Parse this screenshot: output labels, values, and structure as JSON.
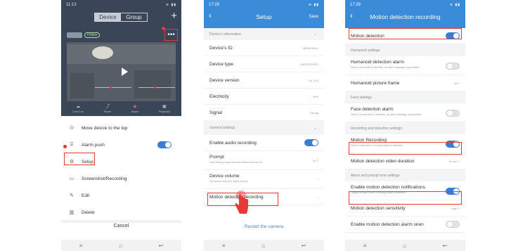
{
  "phone1": {
    "status_time": "11:13",
    "tabs": [
      {
        "label": "Device",
        "active": true
      },
      {
        "label": "Group",
        "active": false
      }
    ],
    "device_status": "Online",
    "more_icon": "ellipsis-icon",
    "controls": [
      {
        "label": "Cloud on",
        "icon": "cloud-icon"
      },
      {
        "label": "Share",
        "icon": "share-icon"
      },
      {
        "label": "Alarm",
        "icon": "alarm-icon"
      },
      {
        "label": "Playback",
        "icon": "playback-icon"
      }
    ],
    "menu": [
      {
        "label": "Move device to the top",
        "icon": "arrow-up-circle-icon",
        "toggle": null
      },
      {
        "label": "Alarm push",
        "icon": "bell-icon",
        "toggle": true
      },
      {
        "label": "Setup",
        "icon": "gear-icon",
        "toggle": null
      },
      {
        "label": "Screenshot/Recording",
        "icon": "image-icon",
        "toggle": null
      },
      {
        "label": "Edit",
        "icon": "pencil-icon",
        "toggle": null
      },
      {
        "label": "Delete",
        "icon": "trash-icon",
        "toggle": null
      }
    ],
    "cancel": "Cancel"
  },
  "phone2": {
    "status_time": "17:29",
    "title": "Setup",
    "save": "Save",
    "section1": "Device's information",
    "info_rows": [
      {
        "label": "Device's ID",
        "value": "3604816691"
      },
      {
        "label": "Device type",
        "value": "BATTERYIPC"
      },
      {
        "label": "Device version",
        "value": "3.0.13.0"
      },
      {
        "label": "Electricity",
        "value": "39%"
      },
      {
        "label": "Signal",
        "value": "Strong"
      }
    ],
    "section2": "General settings",
    "enable_audio": "Enable audio recording",
    "prompt": {
      "label": "Prompt",
      "sub": "Have audio prompt when the device is turned on",
      "value": "on"
    },
    "volume": {
      "label": "Device volume",
      "sub": "Set device input and output volume"
    },
    "motion_recording": "Motion detection recording",
    "restart": "Restart the camera"
  },
  "phone3": {
    "status_time": "17:29",
    "title": "Motion detection recording",
    "motion_detection": "Motion detection",
    "humanoid_settings": "Humanoid settings",
    "humanoid_alarm": {
      "label": "Humanoid detection alarm",
      "sub": "When a humanoid is detected, an alarm message is generated"
    },
    "humanoid_frame": {
      "label": "Humanoid picture frame",
      "value": "off"
    },
    "face_settings": "Face settings",
    "face_alarm": {
      "label": "Face detection alarm",
      "sub": "When a human face is detected, an alarm message is generated"
    },
    "rec_settings": "Recording and detection settings",
    "motion_recording": {
      "label": "Motion Recording",
      "sub": "Record video when a moving object is detected"
    },
    "video_duration": {
      "label": "Motion detection video duration",
      "value": "10 sec"
    },
    "alarm_settings": "Alarm and prompt tone settings",
    "notifications": {
      "label": "Enable motion detection notifications",
      "sub": "Trigger an alarm when a moving object is detected"
    },
    "sensitivity": {
      "label": "Motion detection sensitivity",
      "value": "High"
    },
    "siren": {
      "label": "Enable motion detection alarm siren"
    }
  },
  "colors": {
    "accent": "#3a8bd8",
    "toggle_on": "#3a7bd5",
    "highlight": "#e63a3a",
    "dark_header": "#3a4558"
  }
}
